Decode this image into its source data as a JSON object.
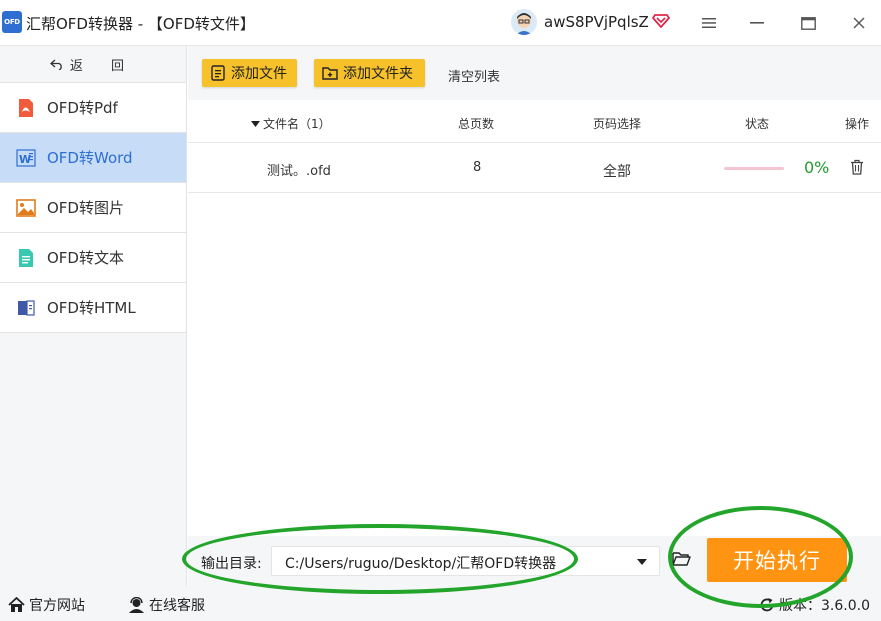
{
  "window": {
    "logo_text": "OFD",
    "title": "汇帮OFD转换器 - 【OFD转文件】",
    "username": "awS8PVjPqlsZ",
    "icons": [
      "vip-icon",
      "menu-icon",
      "maximize-icon",
      "close-icon"
    ]
  },
  "sidebar": {
    "back_label": "返 回",
    "items": [
      {
        "label": "OFD转Pdf",
        "icon": "pdf-icon",
        "active": false
      },
      {
        "label": "OFD转Word",
        "icon": "word-icon",
        "active": true
      },
      {
        "label": "OFD转图片",
        "icon": "image-icon",
        "active": false
      },
      {
        "label": "OFD转文本",
        "icon": "text-icon",
        "active": false
      },
      {
        "label": "OFD转HTML",
        "icon": "html-icon",
        "active": false
      }
    ]
  },
  "toolbar": {
    "add_file": "添加文件",
    "add_folder": "添加文件夹",
    "clear_list": "清空列表"
  },
  "table": {
    "columns": [
      "文件名（1）",
      "总页数",
      "页码选择",
      "状态",
      "操作"
    ],
    "rows": [
      {
        "filename": "测试。.ofd",
        "pages": "8",
        "page_selection": "全部",
        "progress_text": "0%",
        "progress": 0
      }
    ]
  },
  "output": {
    "label": "输出目录:",
    "path": "C:/Users/ruguo/Desktop/汇帮OFD转换器",
    "start_label": "开始执行"
  },
  "statusbar": {
    "website": "官方网站",
    "support": "在线客服",
    "version": "版本：3.6.0.0"
  },
  "colors": {
    "accent_blue": "#2f6fd1",
    "toolbar_button": "#f7c12b",
    "start_button": "#ff9312",
    "progress_text": "#1f9d2e",
    "highlight": "#23a42a"
  }
}
